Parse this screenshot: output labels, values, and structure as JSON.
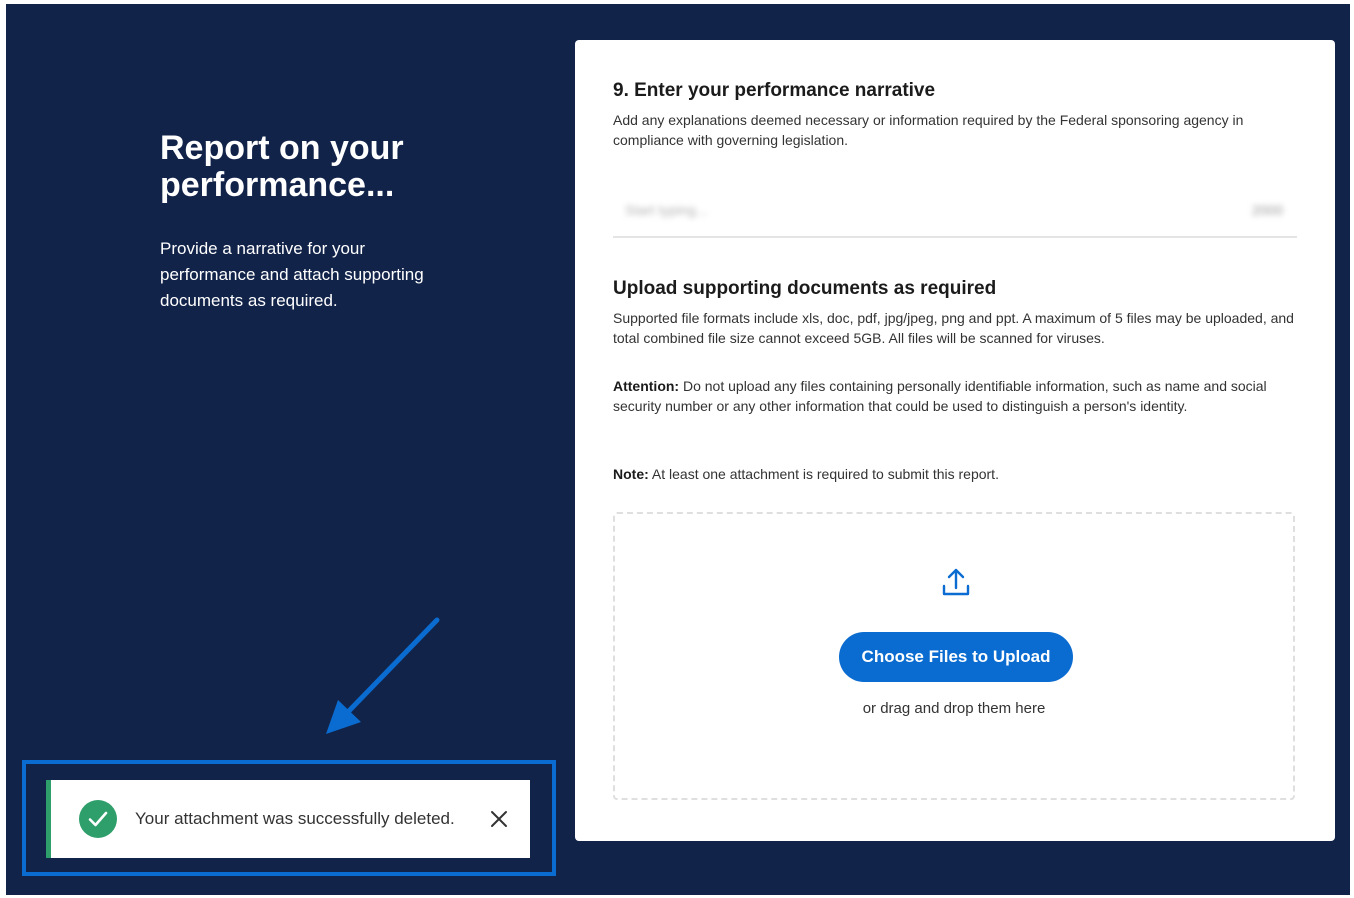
{
  "left_panel": {
    "title": "Report on your performance...",
    "description": "Provide a narrative for your performance and attach supporting documents as required."
  },
  "narrative": {
    "title": "9. Enter your performance narrative",
    "help": "Add any explanations deemed necessary or information required by the Federal sponsoring agency in compliance with governing legislation.",
    "placeholder": "Start typing...",
    "counter": "2000"
  },
  "upload": {
    "title": "Upload supporting documents as required",
    "description": "Supported file formats include xls, doc, pdf, jpg/jpeg, png and ppt. A maximum of 5 files may be uploaded, and total combined file size cannot exceed 5GB. All files will be scanned for viruses.",
    "attention_label": "Attention:",
    "attention_text": " Do not upload any files containing personally identifiable information, such as name and social security number or any other information that could be used to distinguish a person's identity.",
    "note_label": "Note:",
    "note_text": " At least one attachment is required to submit this report.",
    "choose_button": "Choose Files to Upload",
    "drag_text": "or drag and drop them here",
    "icon": "upload-icon"
  },
  "toast": {
    "message": "Your attachment was successfully deleted.",
    "icon": "check-circle-icon",
    "close_icon": "close-icon"
  },
  "colors": {
    "background": "#12234a",
    "accent": "#0a6cd0",
    "success": "#2e9e6b"
  }
}
